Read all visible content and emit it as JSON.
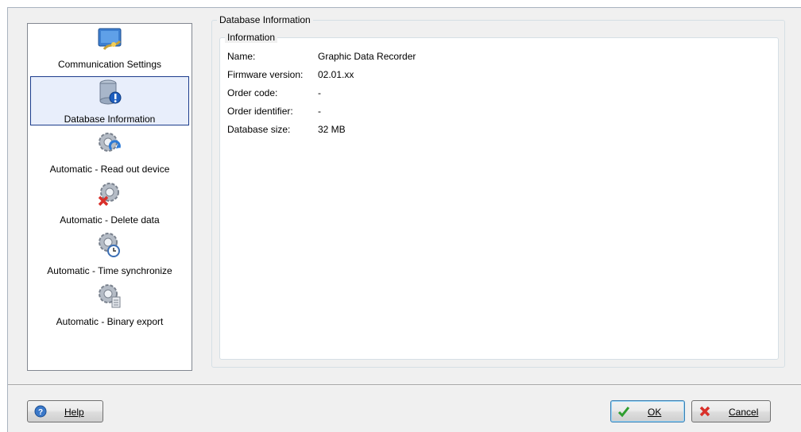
{
  "nav": {
    "items": [
      {
        "label": "Communication Settings",
        "icon": "monitor-network-icon",
        "selected": false
      },
      {
        "label": "Database Information",
        "icon": "database-info-icon",
        "selected": true
      },
      {
        "label": "Automatic - Read out device",
        "icon": "gear-readout-icon",
        "selected": false
      },
      {
        "label": "Automatic - Delete data",
        "icon": "gear-delete-icon",
        "selected": false
      },
      {
        "label": "Automatic - Time synchronize",
        "icon": "gear-clock-icon",
        "selected": false
      },
      {
        "label": "Automatic - Binary export",
        "icon": "gear-export-icon",
        "selected": false
      }
    ]
  },
  "main": {
    "group_title": "Database Information",
    "info_title": "Information",
    "rows": [
      {
        "label": "Name:",
        "value": "Graphic Data Recorder"
      },
      {
        "label": "Firmware version:",
        "value": "02.01.xx"
      },
      {
        "label": "Order code:",
        "value": "-"
      },
      {
        "label": "Order identifier:",
        "value": "-"
      },
      {
        "label": "Database size:",
        "value": "32 MB"
      }
    ]
  },
  "footer": {
    "help_label": "Help",
    "ok_label": "OK",
    "cancel_label": "Cancel"
  },
  "colors": {
    "selection_border": "#1c3c8c",
    "dialog_bg": "#f0f0f0"
  }
}
